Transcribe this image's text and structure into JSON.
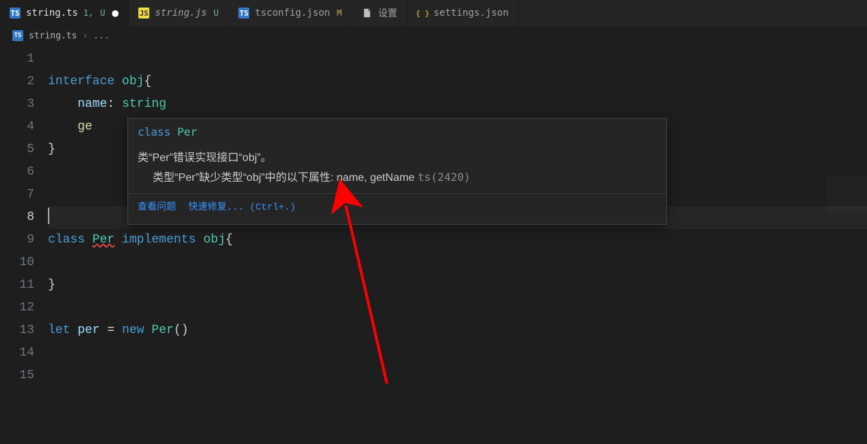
{
  "tabs": [
    {
      "icon": "TS",
      "iconClass": "icon-ts",
      "name": "string.ts",
      "gitNum": "1,",
      "status": "U",
      "statusClass": "u",
      "dirty": true,
      "italic": false,
      "active": true
    },
    {
      "icon": "JS",
      "iconClass": "icon-js",
      "name": "string.js",
      "gitNum": "",
      "status": "U",
      "statusClass": "u",
      "dirty": false,
      "italic": true,
      "active": false
    },
    {
      "icon": "TS",
      "iconClass": "icon-ts",
      "name": "tsconfig.json",
      "gitNum": "",
      "status": "M",
      "statusClass": "m",
      "dirty": false,
      "italic": false,
      "active": false
    },
    {
      "icon": "🗎",
      "iconClass": "icon-file",
      "name": "设置",
      "gitNum": "",
      "status": "",
      "statusClass": "",
      "dirty": false,
      "italic": false,
      "active": false
    },
    {
      "icon": "{ }",
      "iconClass": "icon-json-braces",
      "name": "settings.json",
      "gitNum": "",
      "status": "",
      "statusClass": "",
      "dirty": false,
      "italic": false,
      "active": false
    }
  ],
  "breadcrumb": {
    "icon": "TS",
    "file": "string.ts",
    "sep": "›",
    "ellipsis": "..."
  },
  "gutter": [
    "1",
    "2",
    "3",
    "4",
    "5",
    "6",
    "7",
    "8",
    "9",
    "10",
    "11",
    "12",
    "13",
    "14",
    "15"
  ],
  "currentLine": 8,
  "code": {
    "l2": {
      "kw": "interface",
      "type": "obj",
      "brace": "{"
    },
    "l3": {
      "prop": "name",
      "colon": ":",
      "ptype": "string"
    },
    "l4": {
      "partial": "ge"
    },
    "l5": {
      "brace": "}"
    },
    "l9": {
      "kw1": "class",
      "name": "Per",
      "kw2": "implements",
      "type": "obj",
      "brace": "{"
    },
    "l11": {
      "brace": "}"
    },
    "l13": {
      "kw1": "let",
      "var": "per",
      "eq": "=",
      "kw2": "new",
      "ctor": "Per",
      "paren": "()"
    }
  },
  "hover": {
    "sig_kw": "class",
    "sig_name": "Per",
    "msg1_a": "类",
    "msg1_b": "“Per”",
    "msg1_c": "错误实现接口",
    "msg1_d": "“obj”",
    "msg1_e": "。",
    "msg2_a": "类型",
    "msg2_b": "“Per”",
    "msg2_c": "缺少类型",
    "msg2_d": "“obj”",
    "msg2_e": "中的以下属性: ",
    "msg2_props": "name, getName",
    "msg2_code": "ts(2420)",
    "action_view": "查看问题",
    "action_fix": "快速修复...",
    "action_shortcut": "(Ctrl+.)"
  }
}
